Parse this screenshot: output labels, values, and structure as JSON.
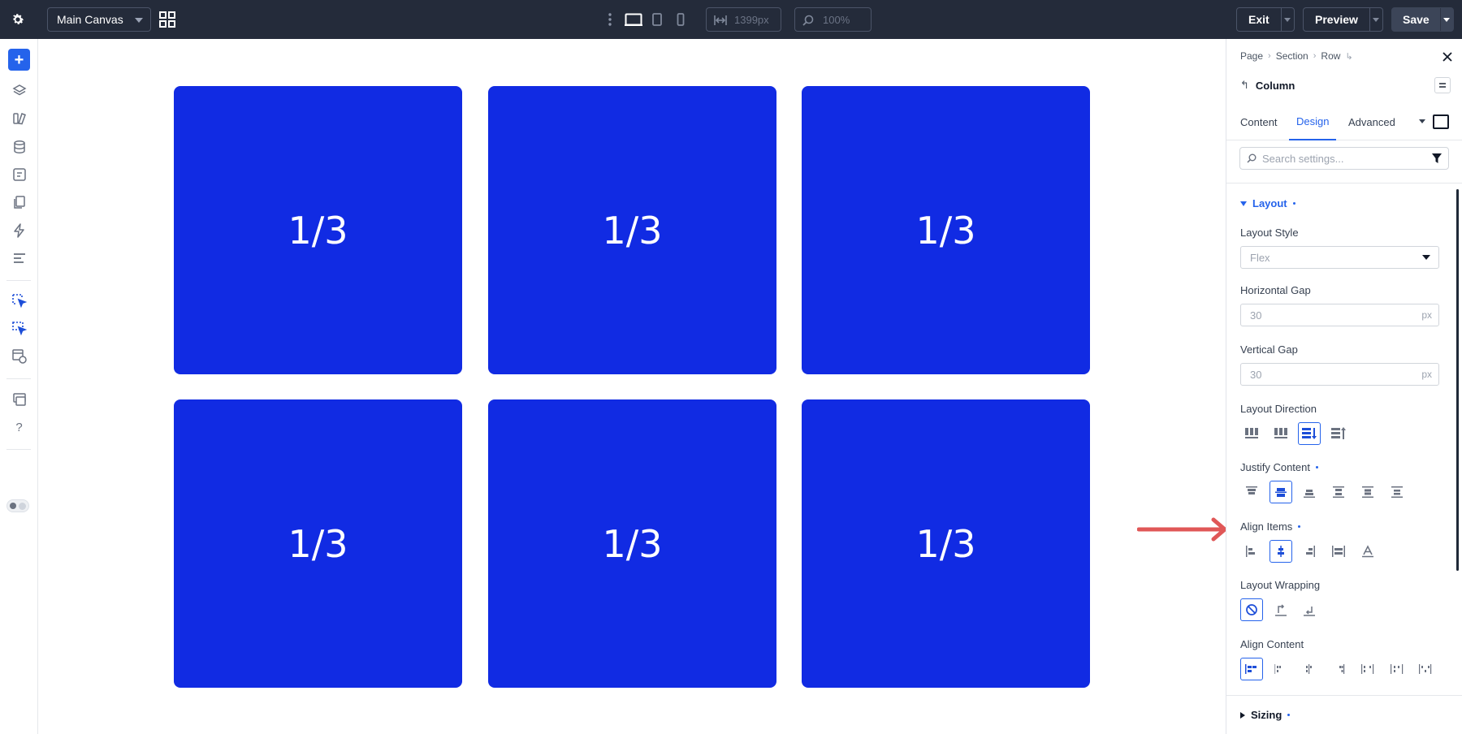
{
  "topbar": {
    "canvas_select": "Main Canvas",
    "width_value": "1399px",
    "zoom_value": "100%",
    "exit_label": "Exit",
    "preview_label": "Preview",
    "save_label": "Save"
  },
  "canvas": {
    "columns": [
      "1/3",
      "1/3",
      "1/3",
      "1/3",
      "1/3",
      "1/3"
    ],
    "column_color": "#112be3",
    "arrow_color": "#e05757"
  },
  "panel": {
    "breadcrumb": [
      "Page",
      "Section",
      "Row"
    ],
    "module_title": "Column",
    "tabs": [
      "Content",
      "Design",
      "Advanced"
    ],
    "active_tab": "Design",
    "search_placeholder": "Search settings...",
    "layout_group": "Layout",
    "layout_style_label": "Layout Style",
    "layout_style_value": "Flex",
    "horizontal_gap_label": "Horizontal Gap",
    "horizontal_gap_value": "30",
    "vertical_gap_label": "Vertical Gap",
    "vertical_gap_value": "30",
    "unit": "px",
    "layout_direction_label": "Layout Direction",
    "justify_content_label": "Justify Content",
    "align_items_label": "Align Items",
    "layout_wrapping_label": "Layout Wrapping",
    "align_content_label": "Align Content",
    "sizing_group": "Sizing"
  },
  "colors": {
    "accent": "#2563eb",
    "topbar_bg": "#242b3a"
  }
}
